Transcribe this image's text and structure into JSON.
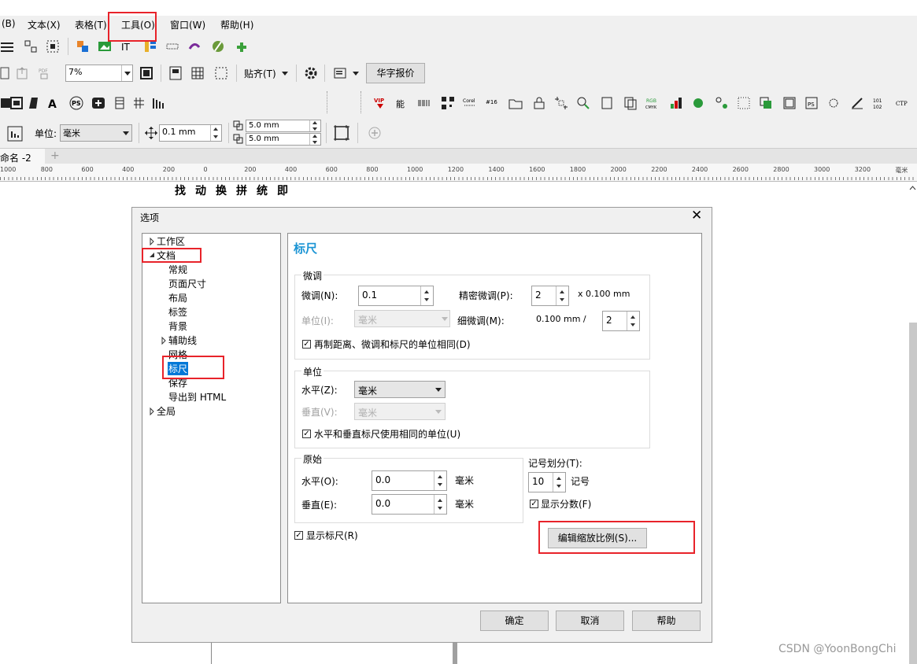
{
  "menubar": {
    "items": [
      "(B)",
      "文本(X)",
      "表格(T)",
      "工具(O)",
      "窗口(W)",
      "帮助(H)"
    ]
  },
  "toolbar2": {
    "zoom": "7%",
    "snap": "贴齐(T)",
    "huazi_button": "华字报价"
  },
  "toolbar3": {
    "glyphs": [
      "找",
      "动",
      "换",
      "拼",
      "统",
      "即"
    ]
  },
  "propbar": {
    "unit_label": "单位:",
    "unit_value": "毫米",
    "nudge": "0.1 mm",
    "dup_x": "5.0 mm",
    "dup_y": "5.0 mm"
  },
  "doc_tab": {
    "label": "命名 -2",
    "add": "+"
  },
  "ruler": {
    "ticks": [
      "1000",
      "800",
      "600",
      "400",
      "200",
      "0",
      "200",
      "400",
      "600",
      "800",
      "1000",
      "1200",
      "1400",
      "1600",
      "1800",
      "2000",
      "2200",
      "2400",
      "2600",
      "2800",
      "3000",
      "3200",
      "毫米"
    ]
  },
  "dialog": {
    "title": "选项",
    "close": "✕",
    "tree": {
      "workspace": "工作区",
      "document": "文档",
      "children": [
        "常规",
        "页面尺寸",
        "布局",
        "标签",
        "背景",
        "辅助线",
        "网格",
        "标尺",
        "保存",
        "导出到 HTML"
      ],
      "global": "全局"
    },
    "panel_title": "标尺",
    "nudge_group": {
      "title": "微调",
      "nudge_label": "微调(N):",
      "nudge_value": "0.1",
      "precise_label": "精密微调(P):",
      "precise_value": "2",
      "precise_suffix": "x 0.100 mm",
      "unit_label": "单位(I):",
      "unit_value": "毫米",
      "fine_label": "细微调(M):",
      "fine_prefix": "0.100 mm /",
      "fine_value": "2",
      "same_units": "再制距离、微调和标尺的单位相同(D)"
    },
    "units_group": {
      "title": "单位",
      "horiz_label": "水平(Z):",
      "horiz_value": "毫米",
      "vert_label": "垂直(V):",
      "vert_value": "毫米",
      "same_units": "水平和垂直标尺使用相同的单位(U)"
    },
    "origin_group": {
      "title": "原始",
      "horiz_label": "水平(O):",
      "horiz_value": "0.0",
      "horiz_unit": "毫米",
      "vert_label": "垂直(E):",
      "vert_value": "0.0",
      "vert_unit": "毫米"
    },
    "ticks": {
      "label": "记号划分(T):",
      "value": "10",
      "suffix": "记号",
      "show_fractions": "显示分数(F)"
    },
    "show_ruler": "显示标尺(R)",
    "edit_scale": "编辑缩放比例(S)...",
    "ok": "确定",
    "cancel": "取消",
    "help": "帮助"
  },
  "watermark": "CSDN @YoonBongChi",
  "colors": {
    "accent": "#1a94d4",
    "highlight": "#0078d7",
    "annotation": "#e8232a"
  }
}
